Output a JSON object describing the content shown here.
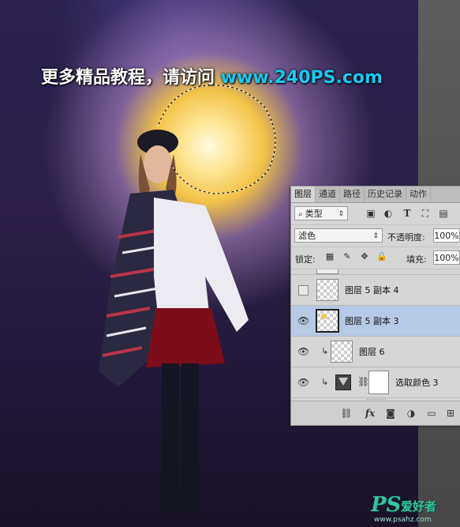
{
  "watermark": {
    "prefix": "更多精品教程，请访问 ",
    "site": "www.240PS.com"
  },
  "panel": {
    "tabs": [
      "图层",
      "通道",
      "路径",
      "历史记录",
      "动作"
    ],
    "active_tab": "图层",
    "filter_label": "类型",
    "blend_mode": "滤色",
    "opacity_label": "不透明度:",
    "opacity_value": "100%",
    "lock_label": "锁定:",
    "fill_label": "填充:",
    "fill_value": "100%",
    "layers": [
      {
        "name": "图层 5 副本 4",
        "visible": false,
        "selected": false
      },
      {
        "name": "图层 5 副本 3",
        "visible": true,
        "selected": true
      },
      {
        "name": "图层 6",
        "visible": true,
        "selected": false,
        "clipped": true
      },
      {
        "name": "选取颜色 3",
        "visible": true,
        "selected": false,
        "clipped": true,
        "adjustment": true
      }
    ]
  },
  "logo": {
    "mark": "PS",
    "name": "爱好者",
    "url": "www.psahz.com"
  },
  "colors": {
    "watermark_site": "#19c8f0",
    "selected_row": "#b6c9e6",
    "logo_green": "#34c3a0"
  }
}
